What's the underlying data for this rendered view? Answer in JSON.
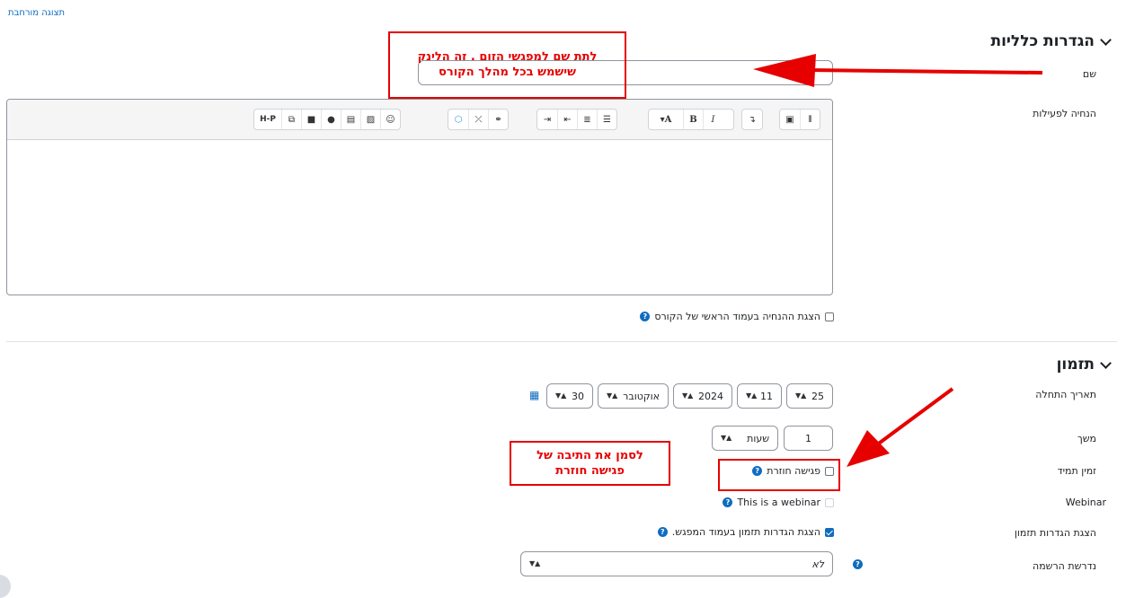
{
  "top_link": "תצוגה מורחבת",
  "sections": {
    "general": {
      "title": "הגדרות כלליות"
    },
    "timing": {
      "title": "תזמון"
    }
  },
  "fields": {
    "name_label": "שם",
    "description_label": "הנחיה לפעילות",
    "show_description_label": "הצגת ההנחיה בעמוד הראשי של הקורס",
    "start_date_label": "תאריך התחלה",
    "duration_label": "משך",
    "recurring_label": "זמין תמיד",
    "webinar_label": "Webinar",
    "show_schedule_label": "הצגת הגדרות תזמון",
    "registration_label": "נדרשת הרשמה"
  },
  "start_date": {
    "day": "30",
    "month": "אוקטובר",
    "year": "2024",
    "hour": "11",
    "minute": "25"
  },
  "duration": {
    "value": "1",
    "unit": "שעות"
  },
  "checkboxes": {
    "recurring_meeting": {
      "label": "פגישה חוזרת",
      "checked": false
    },
    "webinar": {
      "label": "This is a webinar",
      "checked": false,
      "disabled": true
    },
    "show_schedule": {
      "label": "הצגת הגדרות תזמון בעמוד המפגש.",
      "checked": true
    },
    "show_description": {
      "checked": false
    }
  },
  "registration": {
    "value": "לא"
  },
  "toolbar": {
    "buttons": [
      "format-icon",
      "fullscreen-icon",
      "align-icon",
      "font-color-icon",
      "bold-icon",
      "italic-icon",
      "bullet-list-icon",
      "numbered-list-icon",
      "outdent-icon",
      "indent-icon",
      "link-icon",
      "unlink-icon",
      "emoji-icon-ext",
      "emoji-icon",
      "image-icon",
      "media-icon",
      "recorder-icon",
      "video-icon",
      "copy-icon",
      "h5p-icon"
    ],
    "bold_glyph": "B",
    "italic_glyph": "I",
    "font_glyph": "A",
    "h5p_glyph": "H-P"
  },
  "annotations": {
    "name_note_line1": "לתת שם למפגשי הזום . זה הלינק",
    "name_note_line2": "שישמש בכל מהלך הקורס",
    "recurring_note_line1": "לסמן את התיבה של",
    "recurring_note_line2": "פגישה חוזרת"
  },
  "colors": {
    "accent": "#0f6cbf",
    "annotation": "#e60000"
  }
}
